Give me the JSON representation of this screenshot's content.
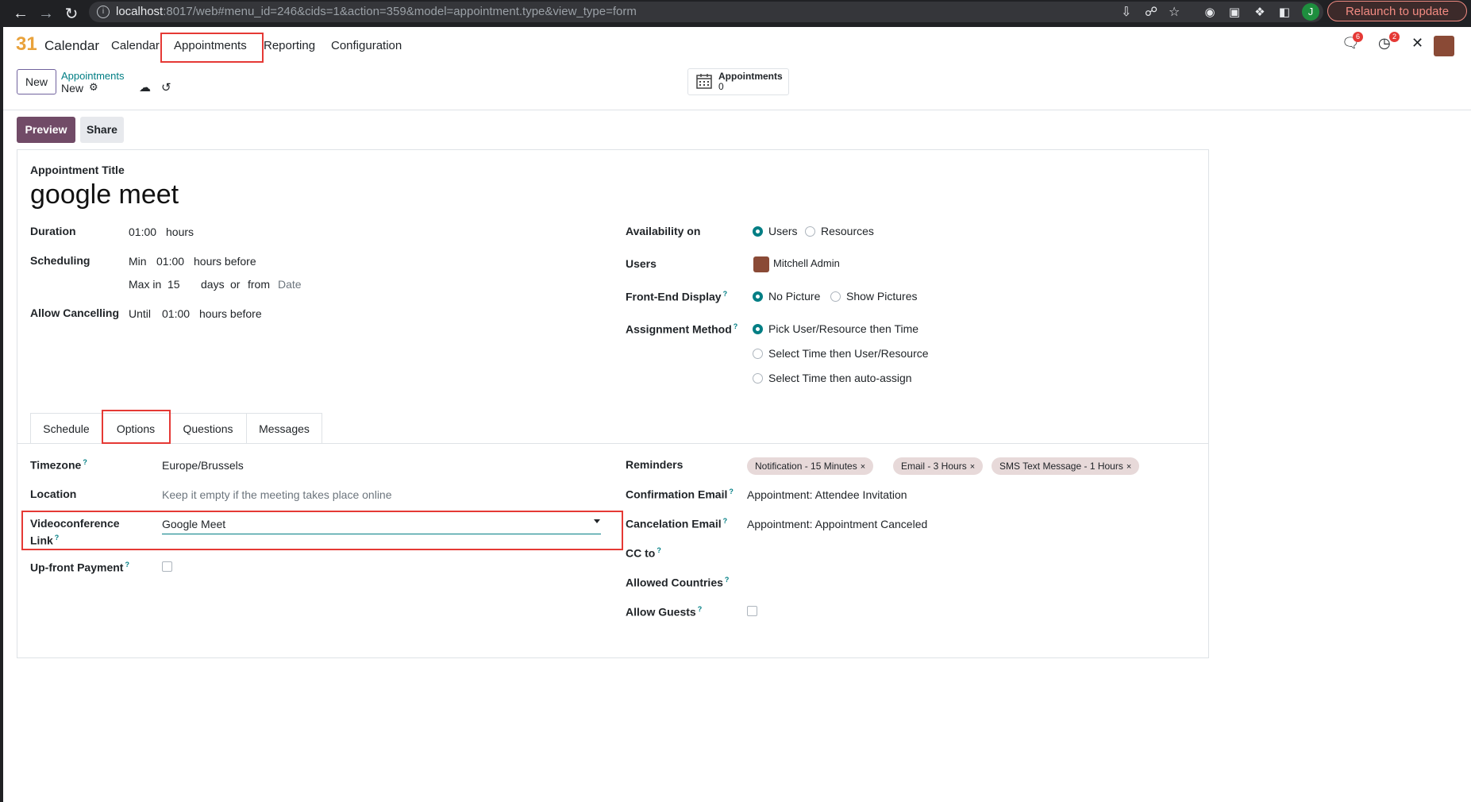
{
  "browser": {
    "url_host": "localhost",
    "url_rest": ":8017/web#menu_id=246&cids=1&action=359&model=appointment.type&view_type=form",
    "profile_initial": "J",
    "relaunch_label": "Relaunch to update"
  },
  "navbar": {
    "app_logo": "31",
    "app_name": "Calendar",
    "menus": [
      "Calendar",
      "Appointments",
      "Reporting",
      "Configuration"
    ],
    "messages_badge": "6",
    "activities_badge": "2"
  },
  "control_panel": {
    "new_label": "New",
    "breadcrumb_parent": "Appointments",
    "breadcrumb_current": "New",
    "stat_label": "Appointments",
    "stat_value": "0"
  },
  "actions": {
    "preview_label": "Preview",
    "share_label": "Share"
  },
  "form": {
    "title_label": "Appointment Title",
    "title_value": "google meet",
    "duration": {
      "label": "Duration",
      "value": "01:00",
      "unit": "hours"
    },
    "scheduling": {
      "label": "Scheduling",
      "min_prefix": "Min",
      "min_value": "01:00",
      "min_suffix": "hours before",
      "max_prefix": "Max in",
      "max_value": "15",
      "max_unit": "days",
      "or": "or",
      "from": "from",
      "from_placeholder": "Date"
    },
    "allow_cancelling": {
      "label": "Allow Cancelling",
      "prefix": "Until",
      "value": "01:00",
      "suffix": "hours before"
    },
    "availability_on": {
      "label": "Availability on",
      "options": [
        "Users",
        "Resources"
      ],
      "selected": "Users"
    },
    "users": {
      "label": "Users",
      "value": "Mitchell Admin"
    },
    "front_end_display": {
      "label": "Front-End Display",
      "options": [
        "No Picture",
        "Show Pictures"
      ],
      "selected": "No Picture"
    },
    "assignment_method": {
      "label": "Assignment Method",
      "options": [
        "Pick User/Resource then Time",
        "Select Time then User/Resource",
        "Select Time then auto-assign"
      ],
      "selected": "Pick User/Resource then Time"
    }
  },
  "tabs": [
    "Schedule",
    "Options",
    "Questions",
    "Messages"
  ],
  "active_tab": "Options",
  "options_tab": {
    "timezone": {
      "label": "Timezone",
      "value": "Europe/Brussels"
    },
    "location": {
      "label": "Location",
      "placeholder": "Keep it empty if the meeting takes place online"
    },
    "videoconference": {
      "label_line1": "Videoconference",
      "label_line2": "Link",
      "value": "Google Meet"
    },
    "upfront_payment": {
      "label": "Up-front Payment",
      "checked": false
    },
    "reminders": {
      "label": "Reminders",
      "tags": [
        "Notification - 15 Minutes",
        "Email - 3 Hours",
        "SMS Text Message - 1 Hours"
      ]
    },
    "confirmation_email": {
      "label": "Confirmation Email",
      "value": "Appointment: Attendee Invitation"
    },
    "cancelation_email": {
      "label": "Cancelation Email",
      "value": "Appointment: Appointment Canceled"
    },
    "cc_to": {
      "label": "CC to"
    },
    "allowed_countries": {
      "label": "Allowed Countries"
    },
    "allow_guests": {
      "label": "Allow Guests",
      "checked": false
    }
  },
  "colors": {
    "primary": "#714b67",
    "accent": "#017e84",
    "highlight": "#e53935"
  }
}
